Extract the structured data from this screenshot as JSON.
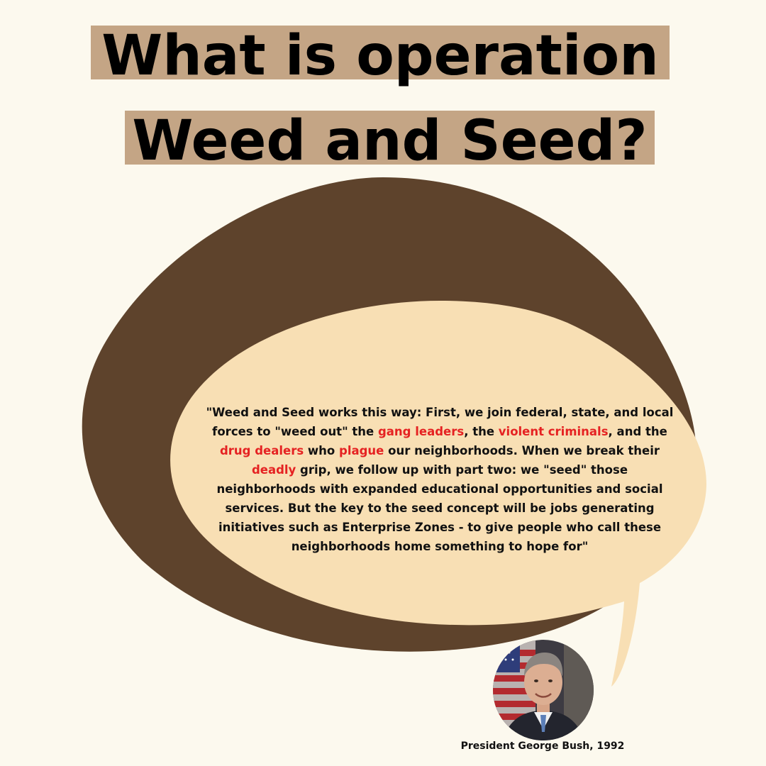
{
  "title": {
    "line1": "What is operation",
    "line2": "Weed and Seed?"
  },
  "quote": {
    "segments": [
      {
        "text": "\"Weed and Seed works this way: First, we join federal, state, and local forces to \"weed out\" the ",
        "highlight": false
      },
      {
        "text": "gang leaders",
        "highlight": true
      },
      {
        "text": ", the ",
        "highlight": false
      },
      {
        "text": "violent criminals",
        "highlight": true
      },
      {
        "text": ", and the ",
        "highlight": false
      },
      {
        "text": "drug dealers",
        "highlight": true
      },
      {
        "text": " who ",
        "highlight": false
      },
      {
        "text": "plague",
        "highlight": true
      },
      {
        "text": " our neighborhoods. When we break their ",
        "highlight": false
      },
      {
        "text": "deadly",
        "highlight": true
      },
      {
        "text": " grip, we follow up with part two: we \"seed\" those neighborhoods with expanded educational opportunities and social services. But the key to the seed concept will be jobs generating initiatives such as Enterprise Zones - to give people who call these neighborhoods home something to hope for\"",
        "highlight": false
      }
    ]
  },
  "caption": "President George Bush, 1992",
  "colors": {
    "background": "#fcf9ee",
    "title_highlight": "#c4a585",
    "dark_bubble": "#5e432c",
    "light_bubble": "#f8dfb4",
    "emphasis": "#e52222"
  }
}
